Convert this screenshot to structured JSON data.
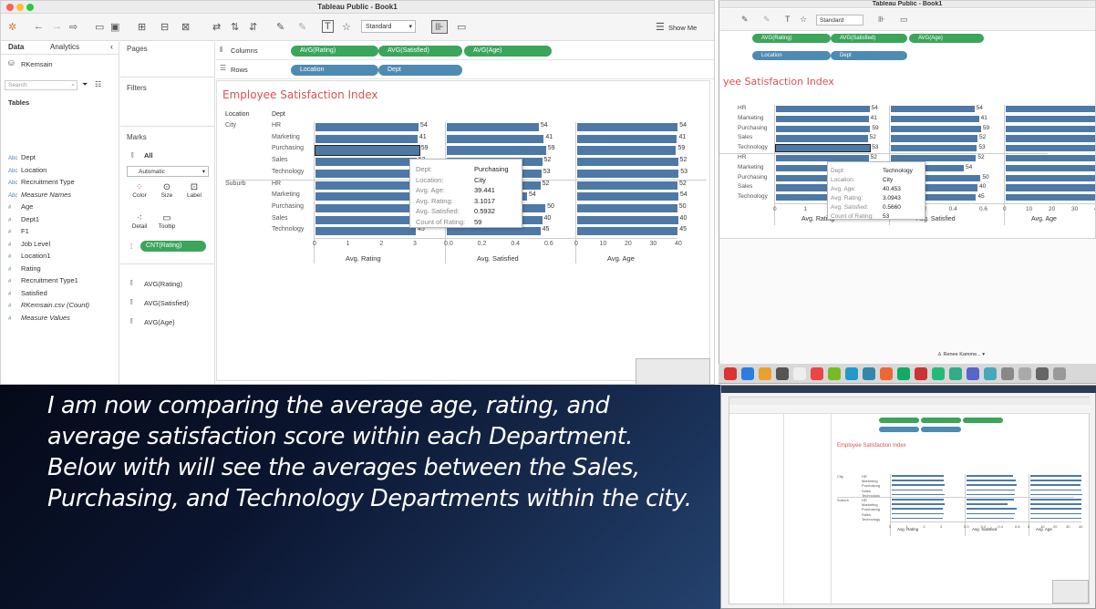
{
  "window": {
    "title": "Tableau Public - Book1",
    "right_title": "Tableau Public - Book1"
  },
  "toolbar": {
    "mark_size": "Standard",
    "show_me": "Show Me"
  },
  "sidebar": {
    "tab_data": "Data",
    "tab_analytics": "Analytics",
    "datasource": "RKemsain",
    "search_placeholder": "Search",
    "tables_header": "Tables",
    "fields": [
      {
        "name": "Dept",
        "icon": "Abc",
        "italic": false
      },
      {
        "name": "Location",
        "icon": "Abc",
        "italic": false
      },
      {
        "name": "Recruitment Type",
        "icon": "Abc",
        "italic": false
      },
      {
        "name": "Measure Names",
        "icon": "Abc",
        "italic": true
      },
      {
        "name": "Age",
        "icon": "#",
        "italic": false
      },
      {
        "name": "Dept1",
        "icon": "#",
        "italic": false
      },
      {
        "name": "F1",
        "icon": "#",
        "italic": false
      },
      {
        "name": "Job Level",
        "icon": "#",
        "italic": false
      },
      {
        "name": "Location1",
        "icon": "#",
        "italic": false
      },
      {
        "name": "Rating",
        "icon": "#",
        "italic": false
      },
      {
        "name": "Recruitment Type1",
        "icon": "#",
        "italic": false
      },
      {
        "name": "Satisfied",
        "icon": "#",
        "italic": false
      },
      {
        "name": "RKemsain.csv (Count)",
        "icon": "#",
        "italic": true
      },
      {
        "name": "Measure Values",
        "icon": "#",
        "italic": true
      }
    ]
  },
  "pages": "Pages",
  "filters": "Filters",
  "marks": {
    "header": "Marks",
    "all": "All",
    "type": "Automatic",
    "buttons": [
      "Color",
      "Size",
      "Label",
      "Detail",
      "Tooltip"
    ],
    "pill": "CNT(Rating)",
    "measures": [
      "AVG(Rating)",
      "AVG(Satisfied)",
      "AVG(Age)"
    ]
  },
  "shelves": {
    "columns_label": "Columns",
    "rows_label": "Rows",
    "columns": [
      "AVG(Rating)",
      "AVG(Satisfied)",
      "AVG(Age)"
    ],
    "rows": [
      "Location",
      "Dept"
    ]
  },
  "chart_data": {
    "type": "bar",
    "title": "Employee Satisfaction Index",
    "row_headers": [
      "Location",
      "Dept"
    ],
    "locations": [
      "City",
      "Suburb"
    ],
    "departments": [
      "HR",
      "Marketing",
      "Purchasing",
      "Sales",
      "Technology"
    ],
    "count_labels": {
      "City": [
        54,
        41,
        59,
        52,
        53
      ],
      "Suburb": [
        52,
        54,
        50,
        40,
        45
      ]
    },
    "series": [
      {
        "name": "Avg. Rating",
        "xlim": [
          0,
          3
        ],
        "ticks": [
          0,
          1,
          2,
          3
        ],
        "City": [
          3.08,
          3.05,
          3.1017,
          3.02,
          3.0943
        ],
        "Suburb": [
          3.05,
          3.1,
          3.0,
          3.03,
          3.0
        ]
      },
      {
        "name": "Avg. Satisfied",
        "xlim": [
          0,
          0.6
        ],
        "ticks": [
          "0.0",
          "0.2",
          "0.4",
          "0.6"
        ],
        "City": [
          0.55,
          0.58,
          0.5932,
          0.57,
          0.566
        ],
        "Suburb": [
          0.56,
          0.48,
          0.59,
          0.57,
          0.56
        ]
      },
      {
        "name": "Avg. Age",
        "xlim": [
          0,
          40
        ],
        "ticks": [
          0,
          10,
          20,
          30,
          40
        ],
        "City": [
          40.1,
          39.8,
          39.441,
          40.2,
          40.453
        ],
        "Suburb": [
          40.0,
          40.3,
          39.9,
          40.2,
          40.1
        ]
      }
    ]
  },
  "tooltip": {
    "keys": [
      "Dept:",
      "Location:",
      "Avg. Age:",
      "Avg. Rating:",
      "Avg. Satisfied:",
      "Count of Rating:"
    ],
    "values": [
      "Purchasing",
      "City",
      "39.441",
      "3.1017",
      "0.5932",
      "59"
    ]
  },
  "right_tooltip": {
    "keys": [
      "Dept:",
      "Location:",
      "Avg. Age:",
      "Avg. Rating:",
      "Avg. Satisfied:",
      "Count of Rating:"
    ],
    "values": [
      "Technology",
      "City",
      "40.453",
      "3.0943",
      "0.5660",
      "53"
    ]
  },
  "right_title": "yee Satisfaction Index",
  "caption": "I am now comparing the average age, rating, and average satisfaction score within each Department. Below with will see the averages between the Sales, Purchasing, and Technology Departments within the city.",
  "colors": {
    "bar": "#4e79a7",
    "pill_green": "#3aa55b",
    "pill_blue": "#4e8bb3",
    "title_red": "#d9534f"
  }
}
